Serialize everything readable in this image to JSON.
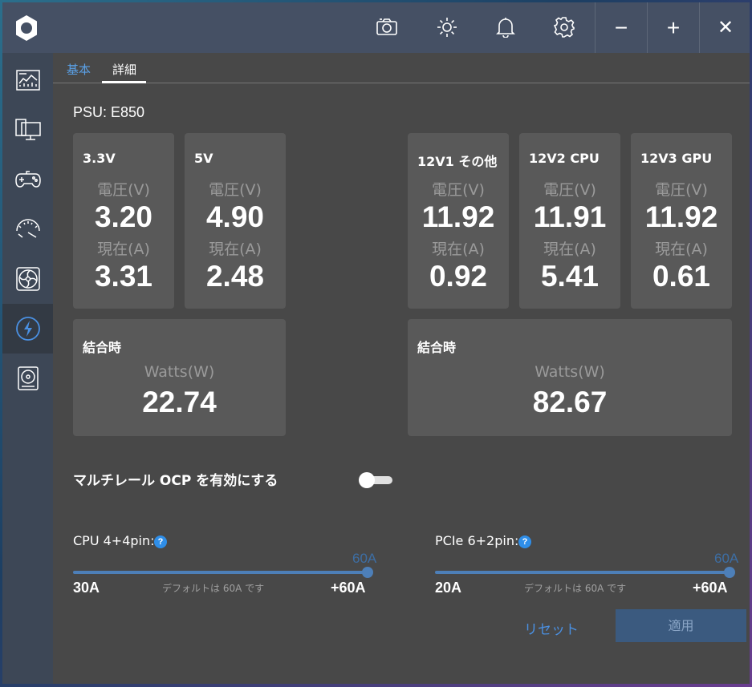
{
  "titlebar": {
    "icons": [
      "camera-icon",
      "brightness-icon",
      "bell-icon",
      "gear-icon"
    ],
    "minimize": "−",
    "maximize": "+",
    "close": "✕"
  },
  "sidebar": {
    "items": [
      {
        "name": "dashboard-icon"
      },
      {
        "name": "system-icon"
      },
      {
        "name": "gamepad-icon"
      },
      {
        "name": "gauge-icon"
      },
      {
        "name": "fan-icon"
      },
      {
        "name": "power-icon",
        "active": true
      },
      {
        "name": "storage-icon"
      }
    ]
  },
  "tabs": [
    {
      "label": "基本"
    },
    {
      "label": "詳細"
    }
  ],
  "psu_title": "PSU: E850",
  "rails": [
    {
      "name": "3.3V",
      "voltage_label": "電圧(V)",
      "voltage": "3.20",
      "current_label": "現在(A)",
      "current": "3.31"
    },
    {
      "name": "5V",
      "voltage_label": "電圧(V)",
      "voltage": "4.90",
      "current_label": "現在(A)",
      "current": "2.48"
    },
    {
      "name": "12V1 その他",
      "voltage_label": "電圧(V)",
      "voltage": "11.92",
      "current_label": "現在(A)",
      "current": "0.92"
    },
    {
      "name": "12V2 CPU",
      "voltage_label": "電圧(V)",
      "voltage": "11.91",
      "current_label": "現在(A)",
      "current": "5.41"
    },
    {
      "name": "12V3 GPU",
      "voltage_label": "電圧(V)",
      "voltage": "11.92",
      "current_label": "現在(A)",
      "current": "0.61"
    }
  ],
  "combined": [
    {
      "name": "結合時",
      "label": "Watts(W)",
      "value": "22.74"
    },
    {
      "name": "結合時",
      "label": "Watts(W)",
      "value": "82.67"
    }
  ],
  "ocp": {
    "label": "マルチレール OCP を有効にする",
    "enabled": false
  },
  "sliders": [
    {
      "label": "CPU 4+4pin:",
      "help": "?",
      "value": "60A",
      "min": "30A",
      "max": "+60A",
      "default_text": "デフォルトは 60A です"
    },
    {
      "label": "PCIe 6+2pin:",
      "help": "?",
      "value": "60A",
      "min": "20A",
      "max": "+60A",
      "default_text": "デフォルトは 60A です"
    }
  ],
  "buttons": {
    "reset": "リセット",
    "apply": "適用"
  }
}
